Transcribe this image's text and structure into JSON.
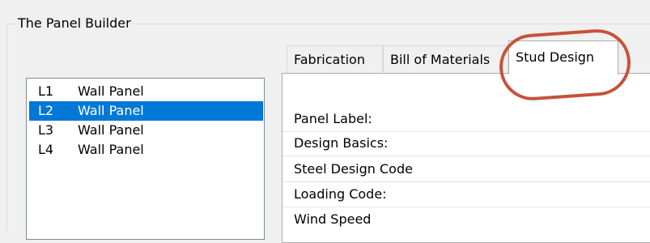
{
  "group": {
    "title": "The Panel Builder"
  },
  "panel_list": {
    "items": [
      {
        "code": "L1",
        "type": "Wall Panel",
        "selected": false
      },
      {
        "code": "L2",
        "type": "Wall Panel",
        "selected": true
      },
      {
        "code": "L3",
        "type": "Wall Panel",
        "selected": false
      },
      {
        "code": "L4",
        "type": "Wall Panel",
        "selected": false
      }
    ]
  },
  "tabs": [
    {
      "label": "Fabrication",
      "active": false
    },
    {
      "label": "Bill of Materials",
      "active": false
    },
    {
      "label": "Stud Design",
      "active": true
    }
  ],
  "stud_design": {
    "fields": [
      {
        "label": "Panel Label:"
      },
      {
        "label": "Design Basics:"
      },
      {
        "label": "Steel Design Code"
      },
      {
        "label": "Loading Code:"
      },
      {
        "label": "Wind Speed"
      }
    ]
  },
  "colors": {
    "window_bg": "#f0f0f0",
    "selection": "#0078d7",
    "highlight_annotation": "#c5533a"
  }
}
